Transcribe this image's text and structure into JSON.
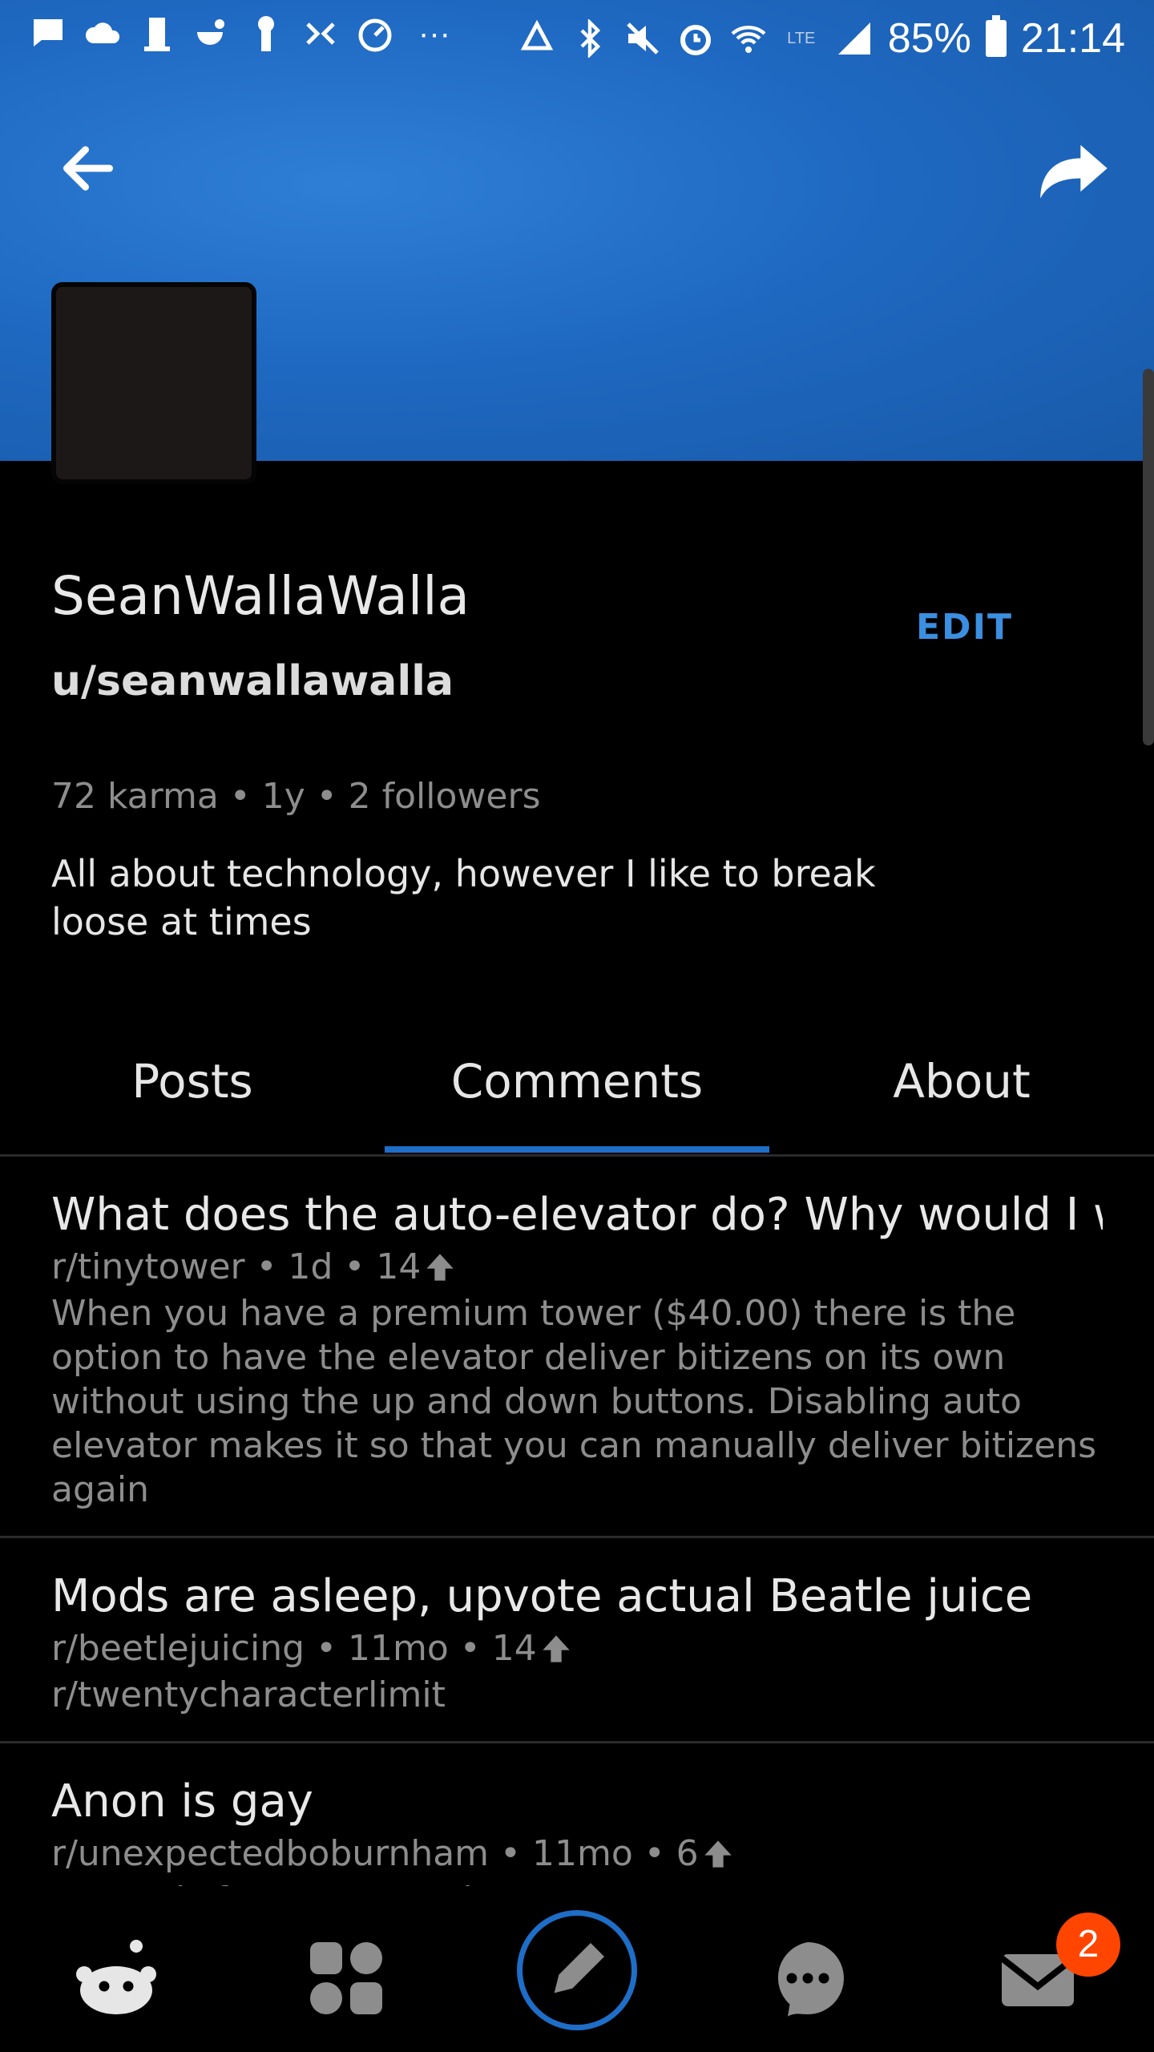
{
  "status_bar": {
    "battery": "85%",
    "time": "21:14",
    "icons": [
      "message-icon",
      "cloud-icon",
      "building-icon",
      "tea-icon",
      "person-icon",
      "game-icon",
      "speedometer-icon",
      "more-icon",
      "recycle-icon",
      "bluetooth-icon",
      "mute-icon",
      "alarm-icon",
      "wifi-icon",
      "lte-icon",
      "signal-icon",
      "battery-icon"
    ]
  },
  "profile": {
    "display_name": "SeanWallaWalla",
    "username": "u/seanwallawalla",
    "edit_label": "EDIT",
    "stats": "72 karma • 1y • 2 followers",
    "bio": "All about technology, however I like to break loose at times"
  },
  "tabs": [
    {
      "label": "Posts"
    },
    {
      "label": "Comments",
      "active": true
    },
    {
      "label": "About"
    }
  ],
  "comments": [
    {
      "title": "What does the auto-elevator do? Why would I w...",
      "meta": "r/tinytower • 1d • 14",
      "body": "When you have a premium tower ($40.00) there is the option to have the elevator deliver bitizens on its own without using the up and down buttons. Disabling auto elevator makes it so that you can manually deliver bitizens again"
    },
    {
      "title": "Mods are asleep, upvote actual Beatle juice",
      "meta": "r/beetlejuicing • 11mo • 14",
      "body": "r/twentycharacterlimit"
    },
    {
      "title": "Anon is gay",
      "meta": "r/unexpectedboburnham • 11mo • 6",
      "body": "It stands for My Face When"
    }
  ],
  "bottom_nav": {
    "items": [
      "home-icon",
      "communities-icon",
      "create-post-icon",
      "chat-icon",
      "inbox-icon"
    ],
    "inbox_badge": "2"
  },
  "colors": {
    "banner": "#1f69c2",
    "accent": "#1e6ec8",
    "edit": "#3b8fe0",
    "badge": "#ff4500"
  }
}
